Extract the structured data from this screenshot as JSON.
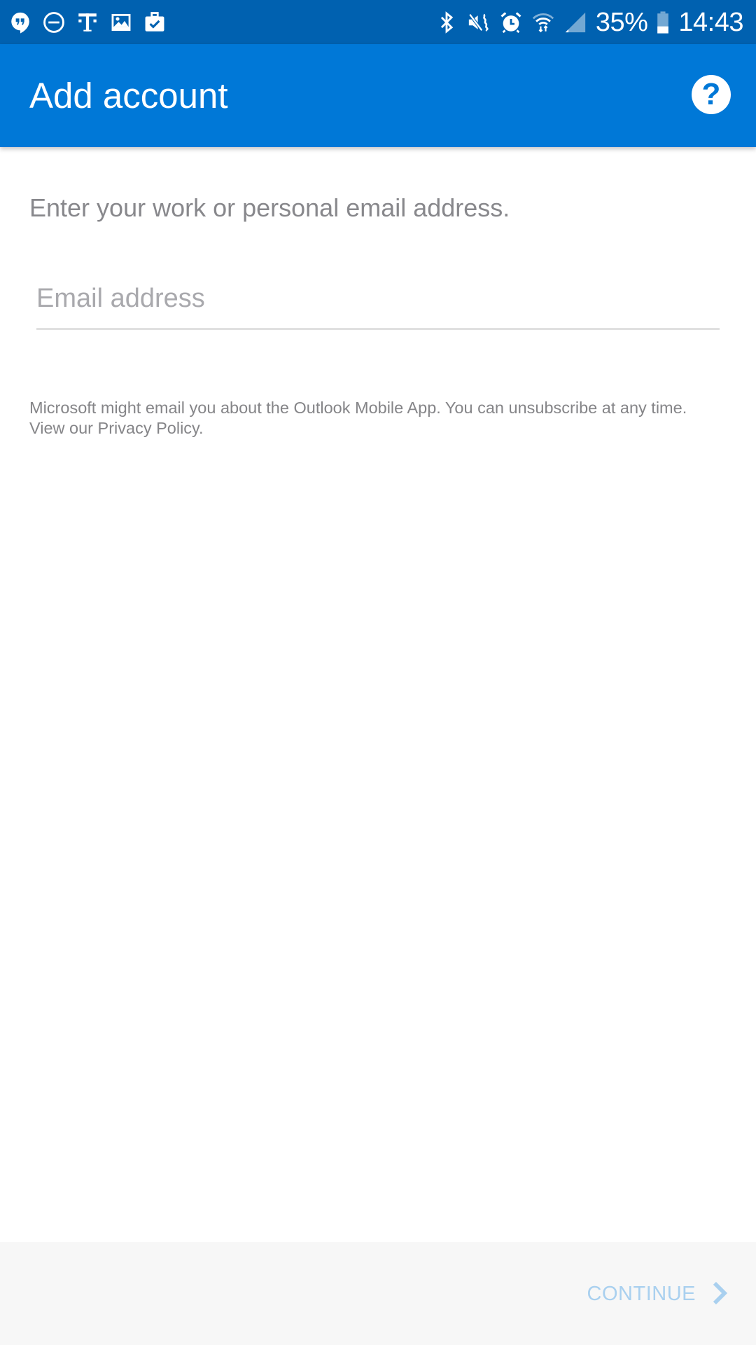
{
  "status_bar": {
    "left_icons": [
      "hangouts-icon",
      "do-not-disturb-icon",
      "t-mobile-icon",
      "gallery-icon",
      "work-profile-icon"
    ],
    "right_icons": [
      "bluetooth-icon",
      "vibrate-mute-icon",
      "alarm-icon",
      "wifi-icon",
      "signal-icon"
    ],
    "battery_percent": "35%",
    "battery_level": 0.35,
    "time": "14:43"
  },
  "app_bar": {
    "title": "Add account",
    "help_icon": "help-icon"
  },
  "main": {
    "prompt": "Enter your work or personal email address.",
    "email_field": {
      "value": "",
      "placeholder": "Email address"
    },
    "disclaimer": "Microsoft might email you about the Outlook Mobile App. You can unsubscribe at any time. View our Privacy Policy."
  },
  "bottom_bar": {
    "continue_label": "CONTINUE",
    "continue_enabled": false
  },
  "colors": {
    "status_bar": "#0061b0",
    "app_bar": "#0078d7",
    "continue_disabled": "#a9d0ef",
    "bottom_bar_bg": "#f7f7f7"
  }
}
